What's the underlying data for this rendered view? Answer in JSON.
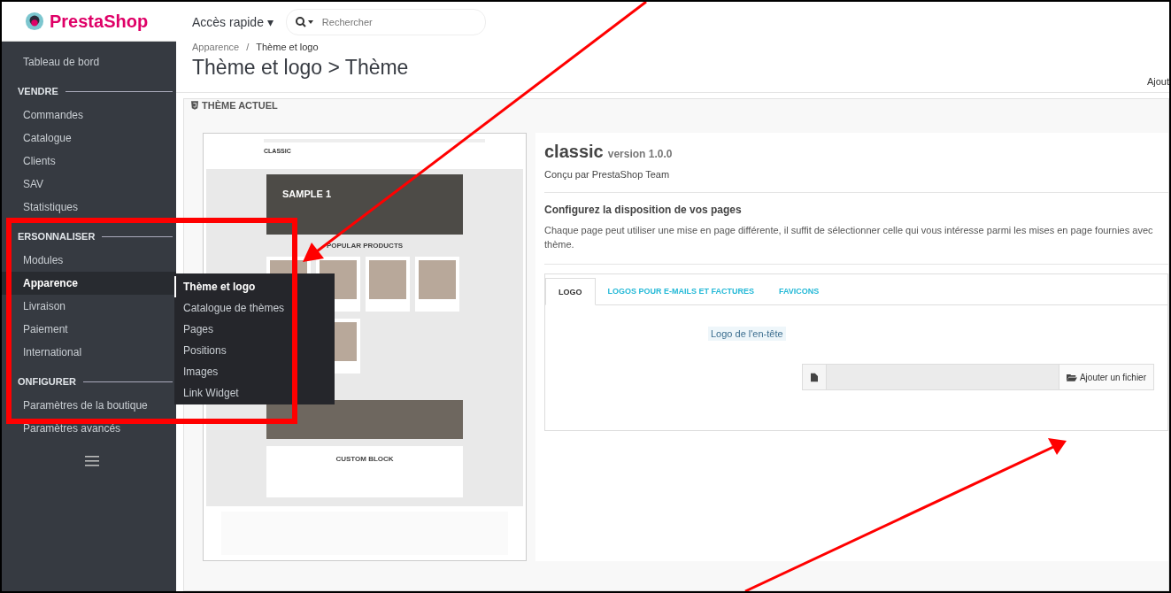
{
  "logo": {
    "text": "PrestaShop"
  },
  "topbar": {
    "quick_access": "Accès rapide",
    "quick_access_caret": "▾",
    "search": {
      "placeholder": "Rechercher"
    }
  },
  "sidebar": {
    "items": [
      {
        "kind": "link",
        "label": "Tableau de bord",
        "selected": false
      },
      {
        "kind": "section",
        "label": "VENDRE"
      },
      {
        "kind": "link",
        "label": "Commandes",
        "selected": false
      },
      {
        "kind": "link",
        "label": "Catalogue",
        "selected": false
      },
      {
        "kind": "link",
        "label": "Clients",
        "selected": false
      },
      {
        "kind": "link",
        "label": "SAV",
        "selected": false
      },
      {
        "kind": "link",
        "label": "Statistiques",
        "selected": false
      },
      {
        "kind": "section",
        "label": "ERSONNALISER"
      },
      {
        "kind": "link",
        "label": "Modules",
        "selected": false
      },
      {
        "kind": "link",
        "label": "Apparence",
        "selected": true
      },
      {
        "kind": "link",
        "label": "Livraison",
        "selected": false
      },
      {
        "kind": "link",
        "label": "Paiement",
        "selected": false
      },
      {
        "kind": "link",
        "label": "International",
        "selected": false
      },
      {
        "kind": "section",
        "label": "ONFIGURER"
      },
      {
        "kind": "link",
        "label": "Paramètres de la boutique",
        "selected": false
      },
      {
        "kind": "link",
        "label": "Paramètres avancés",
        "selected": false
      }
    ]
  },
  "submenu": {
    "items": [
      {
        "label": "Thème et logo",
        "selected": true
      },
      {
        "label": "Catalogue de thèmes",
        "selected": false
      },
      {
        "label": "Pages",
        "selected": false
      },
      {
        "label": "Positions",
        "selected": false
      },
      {
        "label": "Images",
        "selected": false
      },
      {
        "label": "Link Widget",
        "selected": false
      }
    ]
  },
  "breadcrumb": [
    "Apparence",
    "Thème et logo"
  ],
  "breadcrumb_separator": "/",
  "page_title": "Thème et logo > Thème",
  "toolbar_button": "Ajout",
  "panel": {
    "heading": "THÈME ACTUEL"
  },
  "preview": {
    "brand": "CLASSIC",
    "slide_title": "SAMPLE 1",
    "section_title": "POPULAR PRODUCTS",
    "custom_block": "CUSTOM BLOCK"
  },
  "theme": {
    "name": "classic",
    "version": "version 1.0.0",
    "author": "Conçu par PrestaShop Team",
    "layout_title": "Configurez la disposition de vos pages",
    "layout_text": "Chaque page peut utiliser une mise en page différente, il suffit de sélectionner celle qui vous intéresse parmi les mises en page fournies avec thème."
  },
  "tabs": [
    {
      "label": "LOGO",
      "selected": true
    },
    {
      "label": "LOGOS POUR E-MAILS ET FACTURES",
      "selected": false
    },
    {
      "label": "FAVICONS",
      "selected": false
    }
  ],
  "logo_form": {
    "label": "Logo de l'en-tête",
    "button": "Ajouter un fichier"
  }
}
